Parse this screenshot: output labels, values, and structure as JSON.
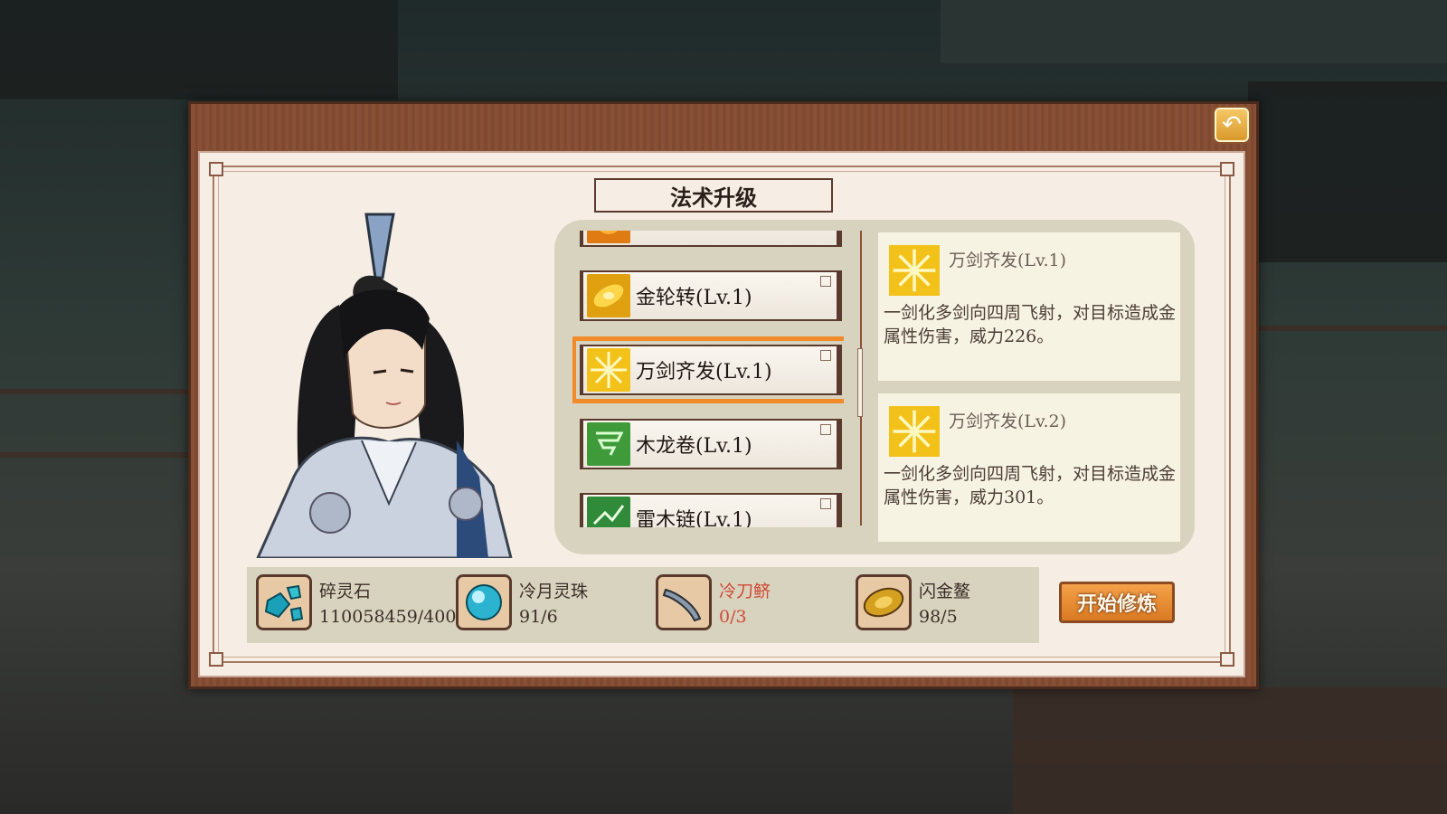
{
  "dialog": {
    "title": "法术升级"
  },
  "skills": [
    {
      "name": ""
    },
    {
      "name": "金轮转(Lv.1)"
    },
    {
      "name": "万剑齐发(Lv.1)",
      "selected": true
    },
    {
      "name": "木龙卷(Lv.1)"
    },
    {
      "name": "雷木链(Lv.1)"
    }
  ],
  "current": {
    "title": "万剑齐发(Lv.1)",
    "desc": "一剑化多剑向四周飞射，对目标造成金属性伤害，威力226。"
  },
  "next": {
    "title": "万剑齐发(Lv.2)",
    "desc": "一剑化多剑向四周飞射，对目标造成金属性伤害，威力301。"
  },
  "resources": [
    {
      "name": "碎灵石",
      "count": "110058459/400",
      "insufficient": false,
      "icon": "spirit-stone-icon"
    },
    {
      "name": "冷月灵珠",
      "count": "91/6",
      "insufficient": false,
      "icon": "moon-pearl-icon"
    },
    {
      "name": "冷刀鲚",
      "count": "0/3",
      "insufficient": true,
      "icon": "fish-icon"
    },
    {
      "name": "闪金鳌",
      "count": "98/5",
      "insufficient": false,
      "icon": "golden-turtle-icon"
    }
  ],
  "buttons": {
    "start": "开始修炼"
  },
  "colors": {
    "selected_outline": "#f08a2a",
    "insufficient": "#d04a35",
    "frame": "#8a5036"
  }
}
